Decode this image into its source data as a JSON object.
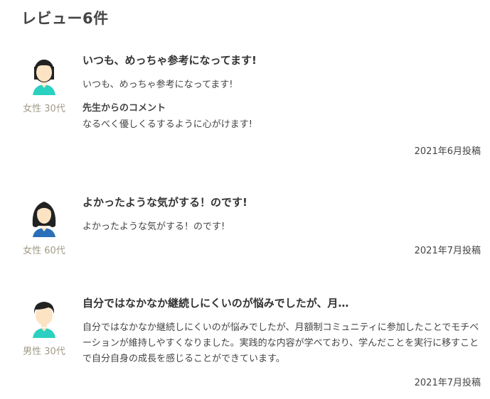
{
  "section": {
    "title": "レビュー6件"
  },
  "reviews": [
    {
      "avatar_icon": "female-avatar-icon",
      "demographic": "女性 30代",
      "title": "いつも、めっちゃ参考になってます!",
      "body": "いつも、めっちゃ参考になってます!",
      "comment_label": "先生からのコメント",
      "comment": "なるべく優しくるするように心がけます!",
      "date": "2021年6月投稿"
    },
    {
      "avatar_icon": "female-avatar-icon",
      "demographic": "女性 60代",
      "title": "よかったような気がする！のです!",
      "body": "よかったような気がする！のです!",
      "date": "2021年7月投稿"
    },
    {
      "avatar_icon": "male-avatar-icon",
      "demographic": "男性 30代",
      "title": "自分ではなかなか継続しにくいのが悩みでしたが、月…",
      "body": "自分ではなかなか継続しにくいのが悩みでしたが、月額制コミュニティに参加したことでモチベーションが維持しやすくなりました。実践的な内容が学べており、学んだことを実行に移すことで自分自身の成長を感じることができています。",
      "date": "2021年7月投稿"
    }
  ],
  "colors": {
    "heading": "#444444",
    "demographic": "#a09a85",
    "skin": "#fbe3c4",
    "hair": "#222222",
    "shirt_teal": "#2ad1c0",
    "shirt_blue": "#2a6fb8"
  }
}
